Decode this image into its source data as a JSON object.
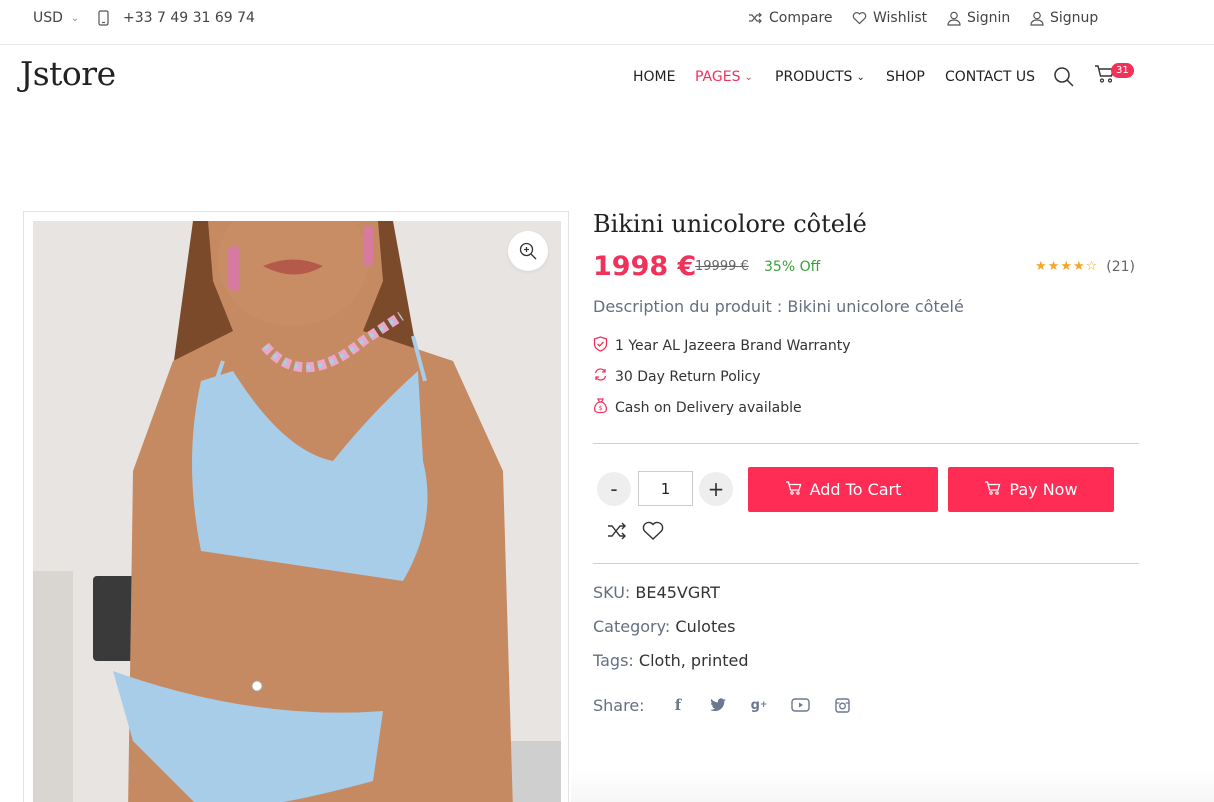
{
  "topbar": {
    "currency": "USD",
    "phone": "+33 7 49 31 69 74",
    "compare": "Compare",
    "wishlist": "Wishlist",
    "signin": "Signin",
    "signup": "Signup"
  },
  "header": {
    "logo": "Jstore",
    "nav": {
      "home": "HOME",
      "pages": "PAGES",
      "products": "PRODUCTS",
      "shop": "SHOP",
      "contact": "CONTACT US"
    },
    "cart_count": "31"
  },
  "product": {
    "title": "Bikini unicolore côtelé",
    "price": "1998 €",
    "old_price": "19999 €",
    "discount": "35% Off",
    "rating_value": 4,
    "rating_count": "(21)",
    "description": "Description du produit : Bikini unicolore côtelé",
    "features": [
      "1 Year AL Jazeera Brand Warranty",
      "30 Day Return Policy",
      "Cash on Delivery available"
    ],
    "quantity": "1",
    "qty_minus": "-",
    "qty_plus": "+",
    "add_to_cart": "Add To Cart",
    "pay_now": "Pay Now",
    "sku_label": "SKU:",
    "sku": "BE45VGRT",
    "category_label": "Category:",
    "category": "Culotes",
    "tags_label": "Tags:",
    "tags": [
      "Cloth",
      "printed"
    ],
    "share_label": "Share:"
  },
  "colors": {
    "accent": "#f0325b",
    "button": "#ff2d55",
    "discount": "#3aa13a",
    "star": "#f5a623",
    "muted": "#666f80"
  },
  "icons": {
    "social": [
      "facebook-icon",
      "twitter-icon",
      "google-plus-icon",
      "youtube-icon",
      "instagram-icon"
    ]
  }
}
